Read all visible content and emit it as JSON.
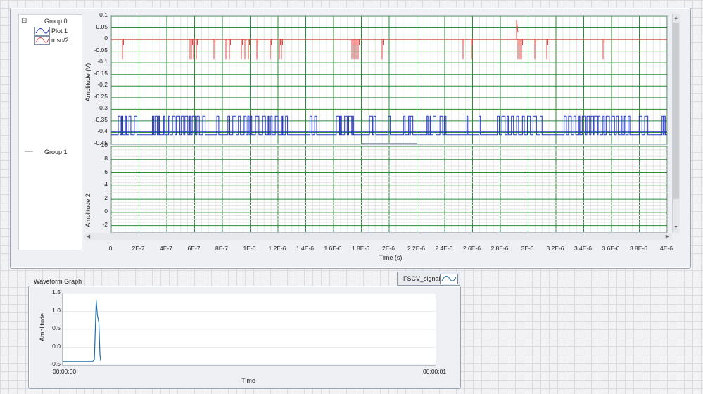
{
  "chart_data": [
    {
      "type": "line",
      "title": "",
      "xlabel": "Time (s)",
      "plots": [
        {
          "ylabel": "Amplitude (V)",
          "ylim": [
            -0.45,
            0.1
          ],
          "yticks": [
            "0.1",
            "0.05",
            "0",
            "-0.05",
            "-0.1",
            "-0.15",
            "-0.2",
            "-0.25",
            "-0.3",
            "-0.35",
            "-0.4",
            "-0.45"
          ],
          "series": [
            {
              "name": "Plot 1",
              "color": "#2637c8",
              "baseline": -0.41,
              "high": -0.33
            },
            {
              "name": "mso/2",
              "color": "#e04848",
              "baseline": 0.0,
              "spike_min": -0.085,
              "spike_max": 0.085
            }
          ]
        },
        {
          "ylabel": "Amplitude 2",
          "ylim": [
            -3,
            10
          ],
          "yticks": [
            "10",
            "8",
            "6",
            "4",
            "2",
            "0",
            "-2"
          ]
        }
      ],
      "xlim": [
        0,
        4e-06
      ],
      "xticks": [
        "0",
        "2E-7",
        "4E-7",
        "6E-7",
        "8E-7",
        "1E-6",
        "1.2E-6",
        "1.4E-6",
        "1.6E-6",
        "1.8E-6",
        "2E-6",
        "2.2E-6",
        "2.4E-6",
        "2.6E-6",
        "2.8E-6",
        "3E-6",
        "3.2E-6",
        "3.4E-6",
        "3.6E-6",
        "3.8E-6",
        "4E-6"
      ],
      "grid": true,
      "legend": {
        "groups": [
          {
            "label": "Group 0",
            "items": [
              "Plot 1",
              "mso/2"
            ]
          },
          {
            "label": "Group 1",
            "items": []
          }
        ]
      }
    },
    {
      "type": "line",
      "title": "Waveform Graph",
      "xlabel": "Time",
      "ylabel": "Amplitude",
      "ylim": [
        -0.5,
        1.5
      ],
      "yticks": [
        "1.5",
        "1.0",
        "0.5",
        "0.0",
        "-0.5"
      ],
      "xticks": [
        "00:00:00",
        "00:00:01"
      ],
      "series": [
        {
          "name": "FSCV_signal",
          "color": "#1b6fa6"
        }
      ],
      "points": [
        [
          0,
          -0.4
        ],
        [
          0.06,
          -0.4
        ],
        [
          0.08,
          -0.4
        ],
        [
          0.085,
          -0.35
        ],
        [
          0.09,
          1.3
        ],
        [
          0.093,
          0.9
        ],
        [
          0.097,
          0.7
        ],
        [
          0.1,
          -0.2
        ],
        [
          0.102,
          -0.38
        ]
      ]
    }
  ],
  "ui": {
    "legend_group0": "Group 0",
    "legend_plot1": "Plot 1",
    "legend_mso": "mso/2",
    "legend_group1": "Group 1",
    "collapse_symbol": "⊟",
    "ylabel1": "Amplitude (V)",
    "ylabel2": "Amplitude 2",
    "xlabel": "Time (s)",
    "wf_title": "Waveform Graph",
    "wf_ylabel": "Amplitude",
    "wf_xlabel": "Time",
    "wf_legend": "FSCV_signal",
    "wf_x0": "00:00:00",
    "wf_x1": "00:00:01",
    "up": "▲",
    "down": "▼",
    "left": "◀",
    "right": "▶"
  }
}
